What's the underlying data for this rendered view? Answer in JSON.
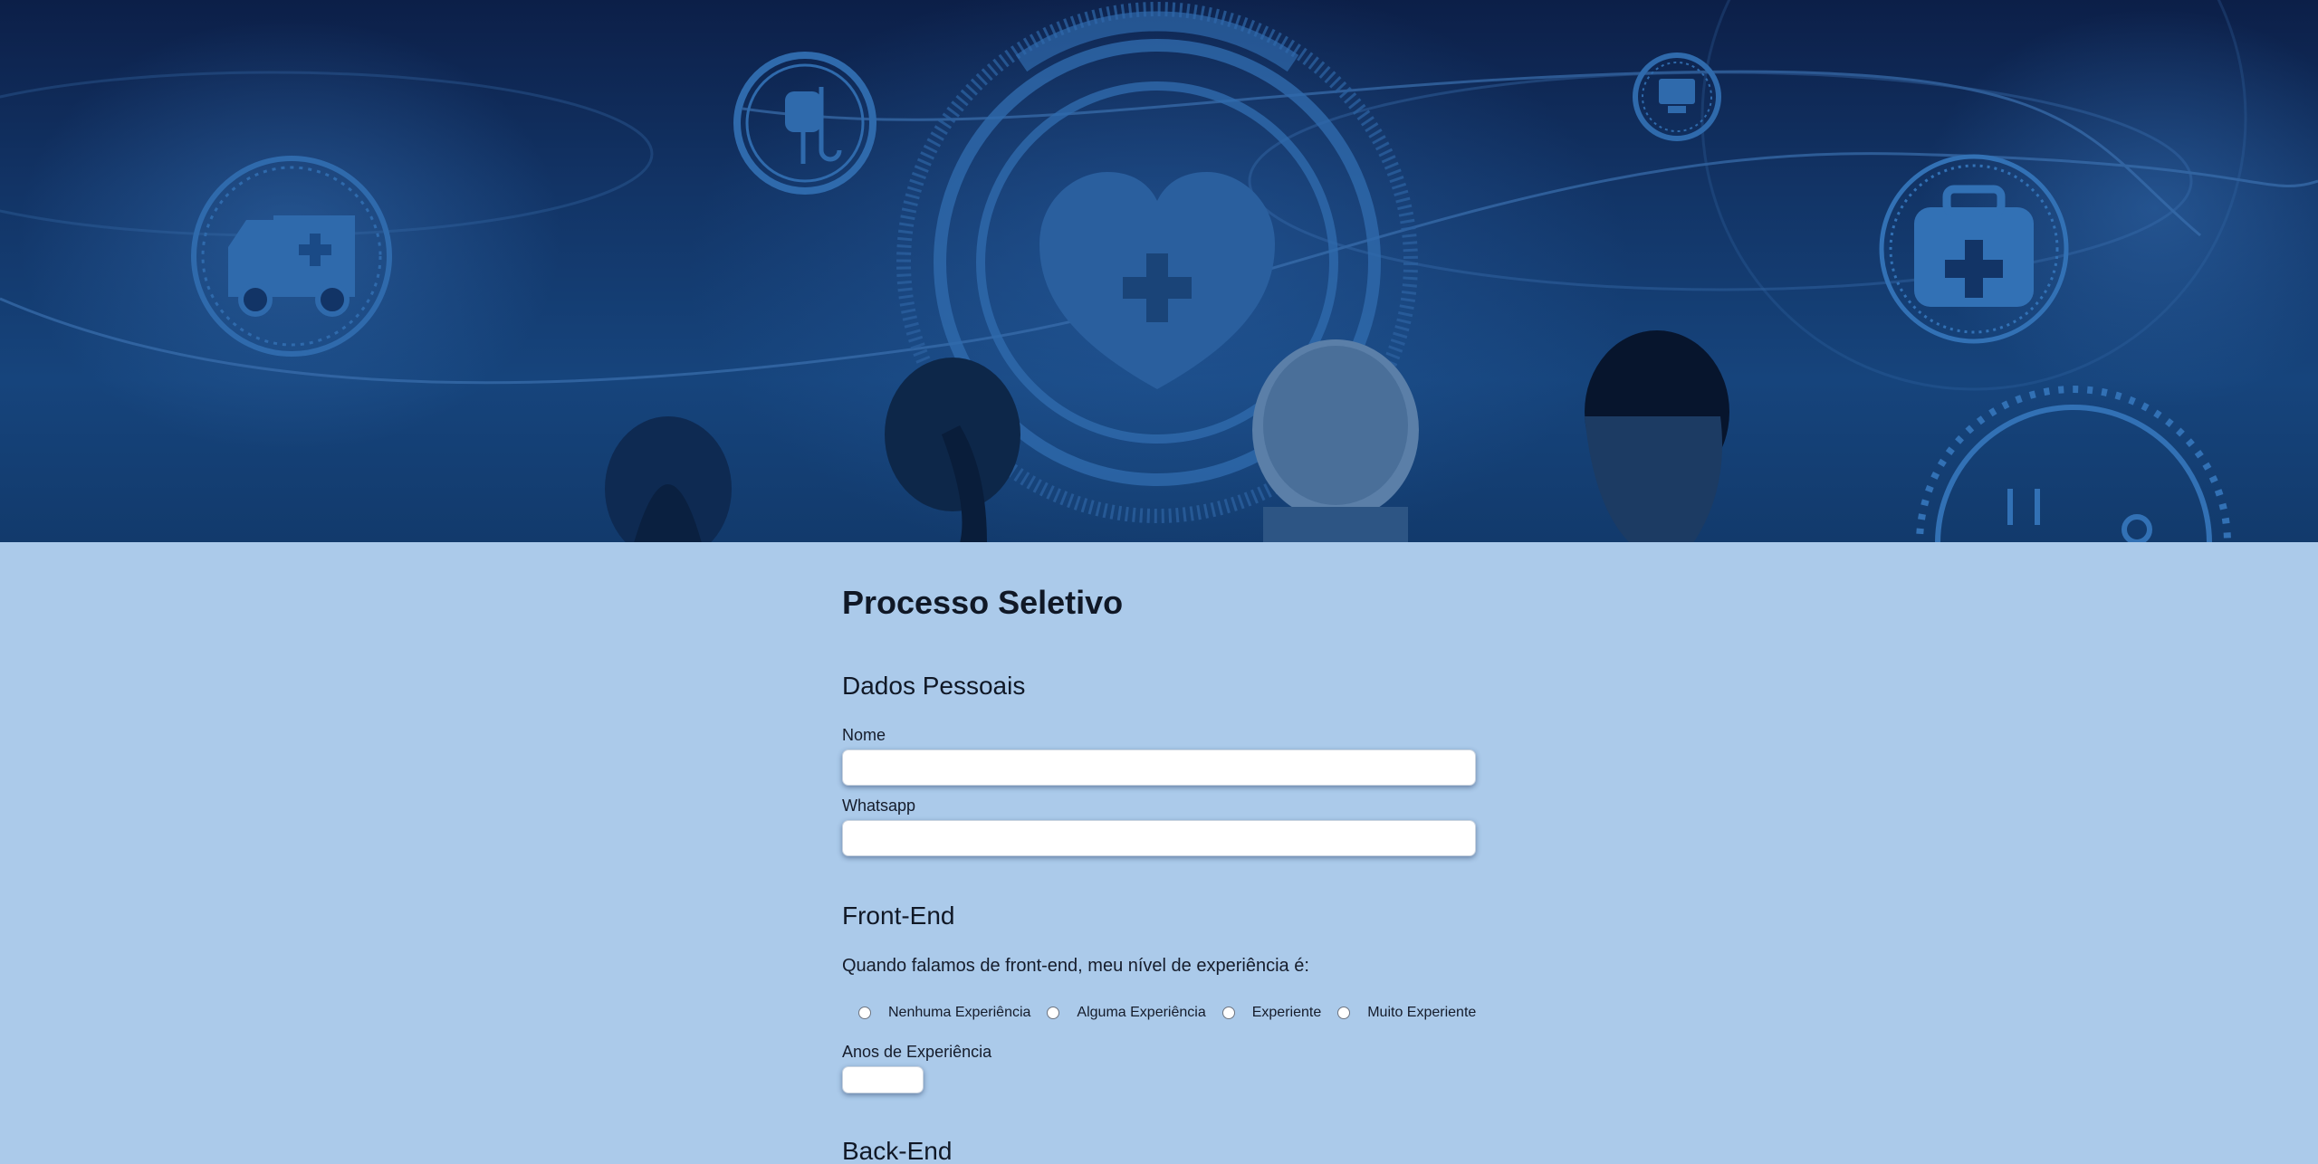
{
  "page": {
    "title": "Processo Seletivo",
    "background_color": "#abcaea",
    "banner_color": "#123466"
  },
  "personal": {
    "section_title": "Dados Pessoais",
    "name_label": "Nome",
    "name_value": "",
    "whatsapp_label": "Whatsapp",
    "whatsapp_value": ""
  },
  "frontend": {
    "section_title": "Front-End",
    "question": "Quando falamos de front-end, meu nível de experiência é:",
    "options": [
      "Nenhuma Experiência",
      "Alguma Experiência",
      "Experiente",
      "Muito Experiente"
    ],
    "years_label": "Anos de Experiência",
    "years_value": ""
  },
  "backend": {
    "section_title": "Back-End"
  },
  "banner_icons": [
    "ambulance-icon",
    "iv-bag-icon",
    "heart-cross-icon",
    "monitor-icon",
    "medical-kit-icon",
    "stethoscope-icon"
  ]
}
